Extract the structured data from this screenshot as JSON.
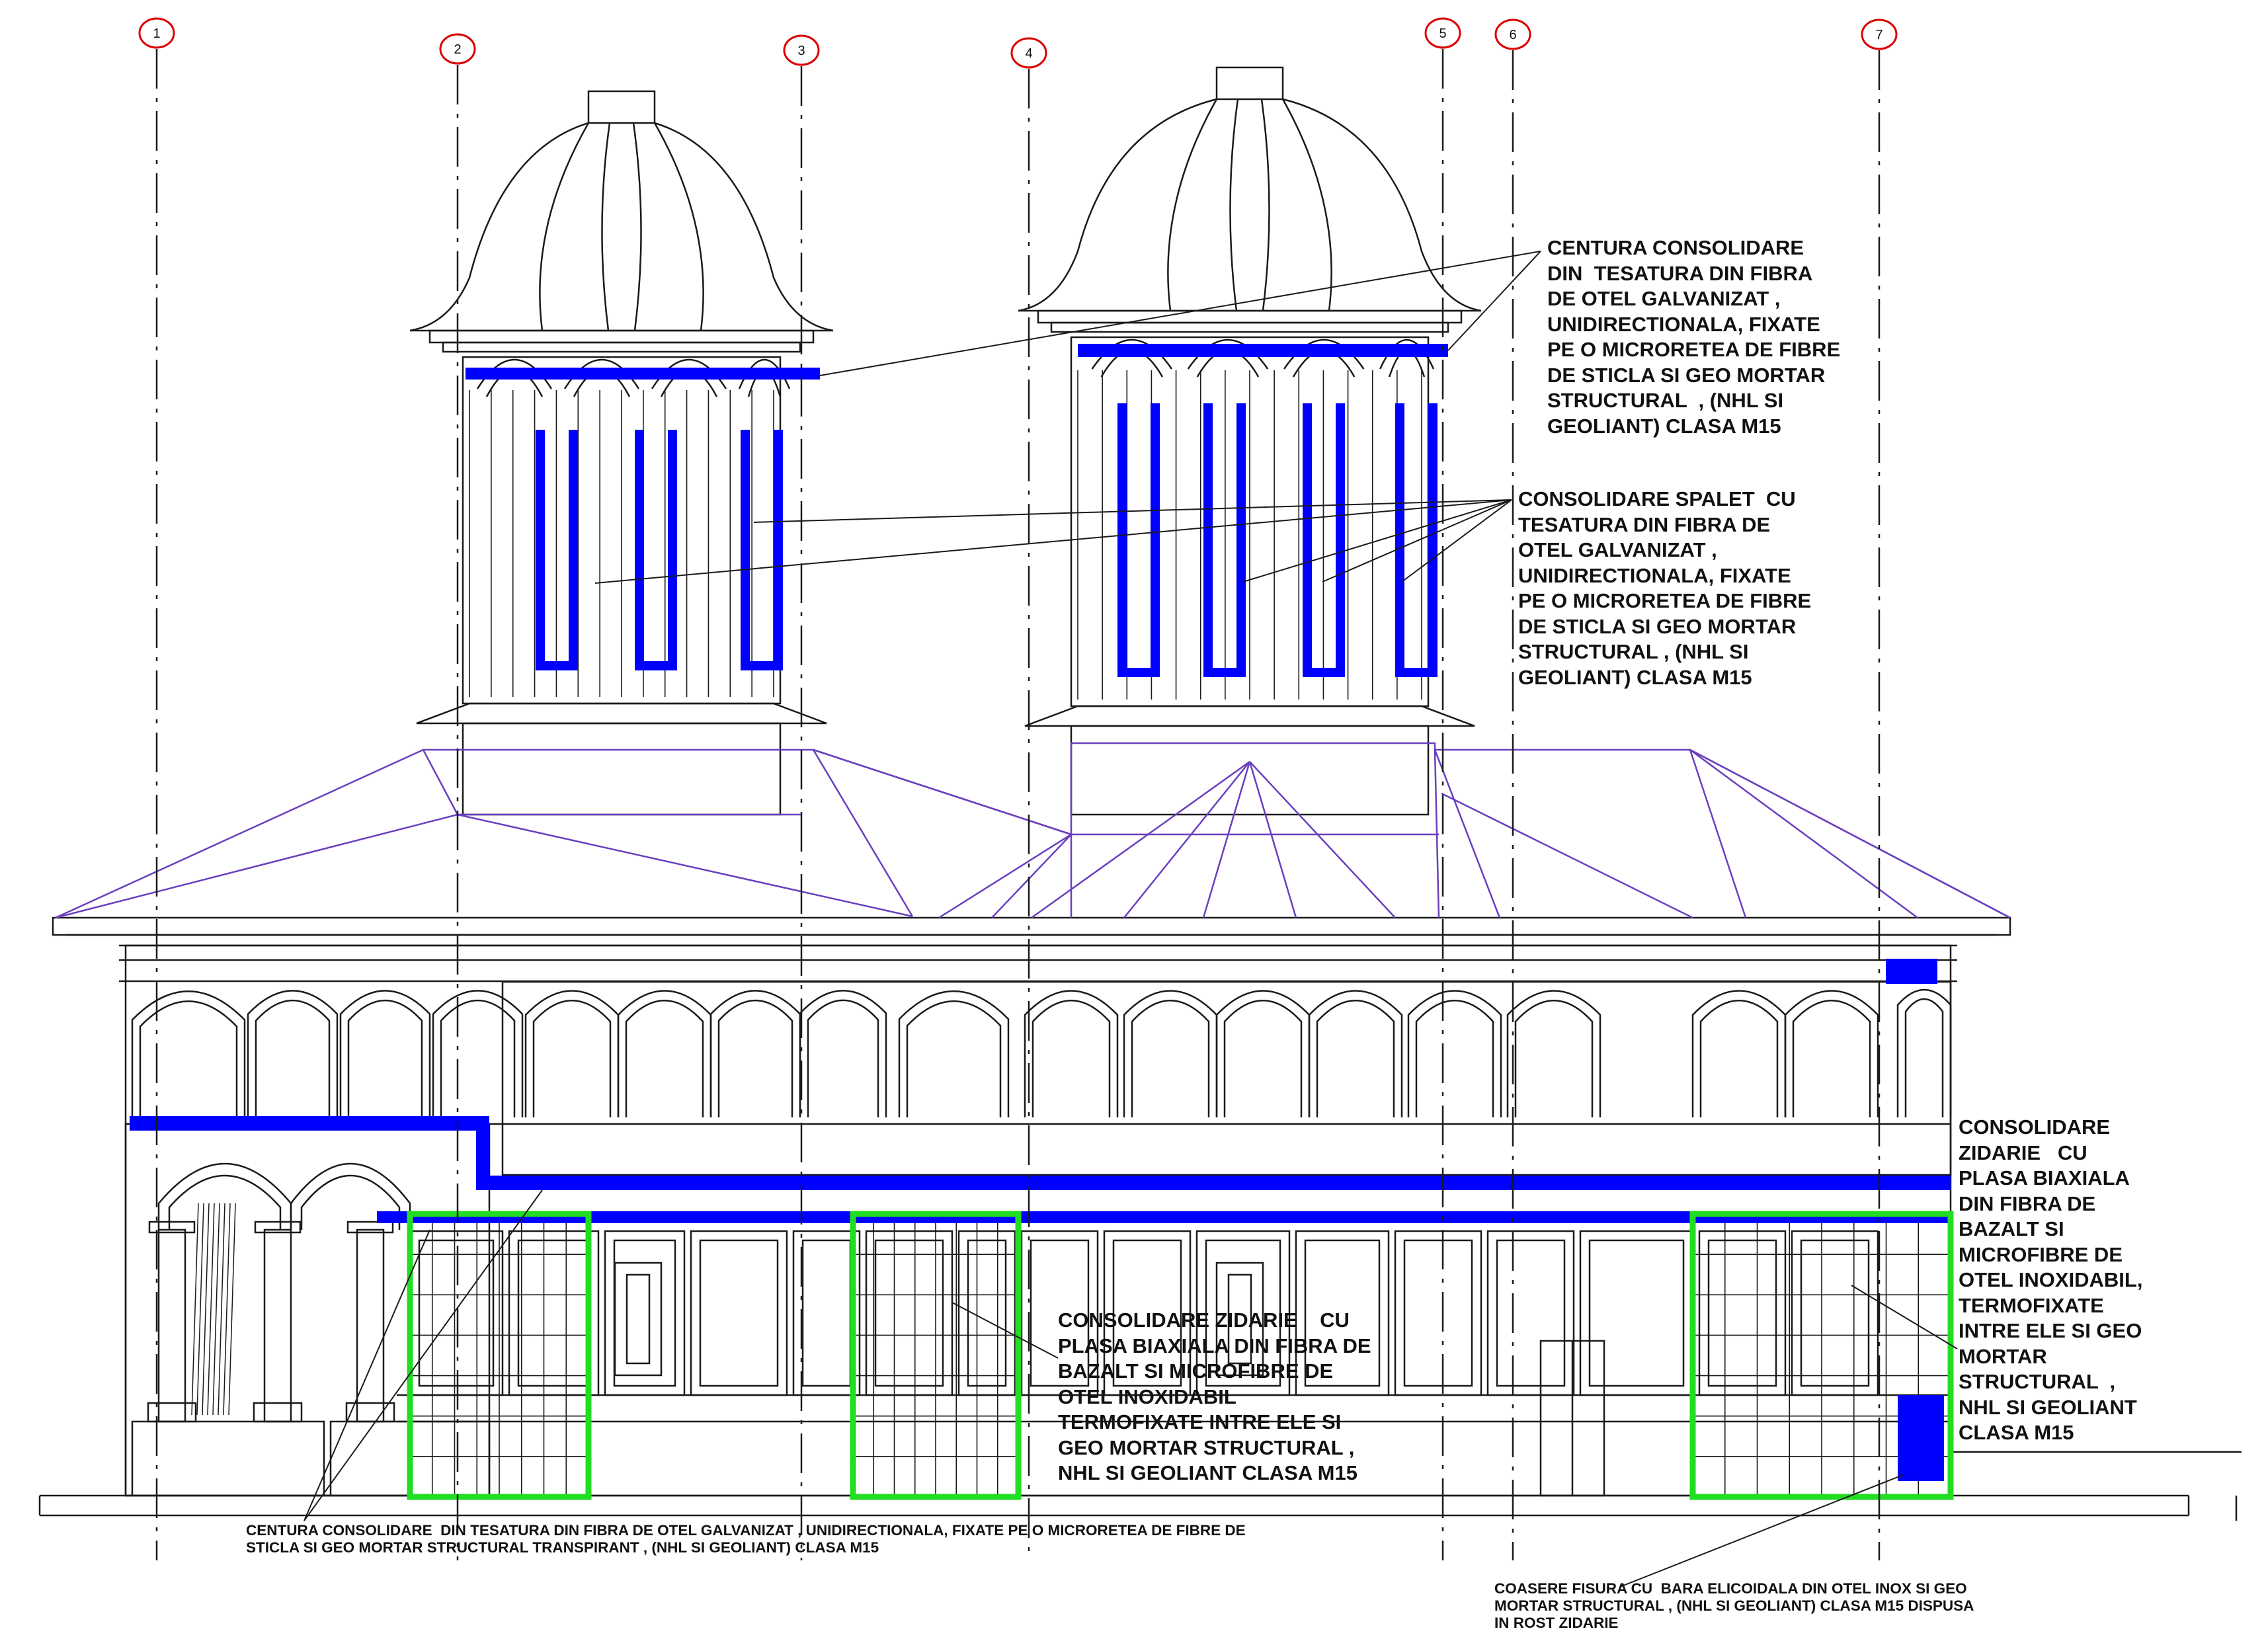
{
  "grid_axes": [
    "1",
    "2",
    "3",
    "4",
    "5",
    "6",
    "7"
  ],
  "colors": {
    "ink": "#1a1a1a",
    "blue_reinforcement": "#0000ff",
    "green_reinforcement": "#22dd22",
    "roof_lines": "#6a3fc0",
    "axis_bubble": "#dd0000"
  },
  "notes": {
    "belt_top": "CENTURA CONSOLIDARE\nDIN  TESATURA DIN FIBRA\nDE OTEL GALVANIZAT ,\nUNIDIRECTIONALA, FIXATE\nPE O MICRORETEA DE FIBRE\nDE STICLA SI GEO MORTAR\nSTRUCTURAL  , (NHL SI\nGEOLIANT) CLASA M15",
    "spalet": "CONSOLIDARE SPALET  CU\nTESATURA DIN FIBRA DE\nOTEL GALVANIZAT ,\nUNIDIRECTIONALA, FIXATE\nPE O MICRORETEA DE FIBRE\nDE STICLA SI GEO MORTAR\nSTRUCTURAL , (NHL SI\nGEOLIANT) CLASA M15",
    "masonry_right": "CONSOLIDARE\nZIDARIE   CU\nPLASA BIAXIALA\nDIN FIBRA DE\nBAZALT SI\nMICROFIBRE DE\nOTEL INOXIDABIL,\nTERMOFIXATE\nINTRE ELE SI GEO\nMORTAR\nSTRUCTURAL  ,\nNHL SI GEOLIANT\nCLASA M15",
    "masonry_center": "CONSOLIDARE ZIDARIE    CU\nPLASA BIAXIALA DIN FIBRA DE\nBAZALT SI MICROFIBRE DE\nOTEL INOXIDABIL\nTERMOFIXATE INTRE ELE SI\nGEO MORTAR STRUCTURAL ,\nNHL SI GEOLIANT CLASA M15",
    "belt_bottom": "CENTURA CONSOLIDARE  DIN TESATURA DIN FIBRA DE OTEL GALVANIZAT , UNIDIRECTIONALA, FIXATE PE O MICRORETEA DE FIBRE DE\nSTICLA SI GEO MORTAR STRUCTURAL TRANSPIRANT , (NHL SI GEOLIANT) CLASA M15",
    "crack": "COASERE FISURA CU  BARA ELICOIDALA DIN OTEL INOX SI GEO\nMORTAR STRUCTURAL , (NHL SI GEOLIANT) CLASA M15 DISPUSA\nIN ROST ZIDARIE"
  }
}
